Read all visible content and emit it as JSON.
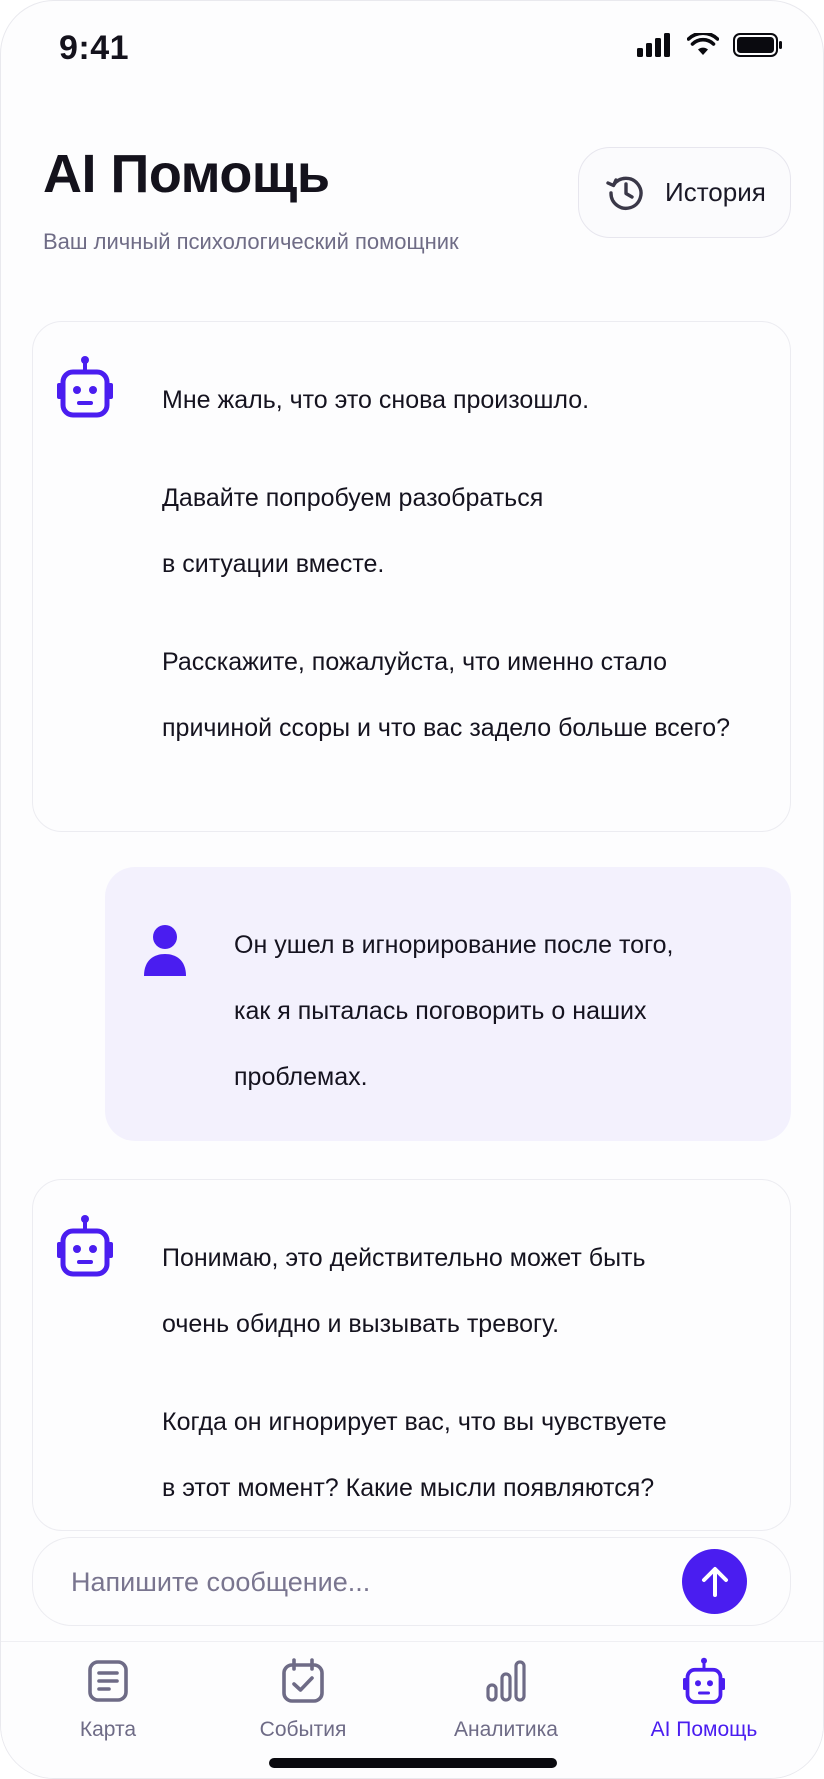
{
  "status_bar": {
    "time": "9:41"
  },
  "header": {
    "title": "AI Помощь",
    "subtitle": "Ваш личный психологический помощник",
    "history_label": "История"
  },
  "messages": [
    {
      "role": "bot",
      "lines": [
        "Мне жаль, что это снова произошло.",
        "Давайте попробуем разобраться",
        "в ситуации вместе.",
        "Расскажите, пожалуйста, что именно стало",
        "причиной ссоры и что вас задело больше всего?"
      ]
    },
    {
      "role": "user",
      "lines": [
        "Он ушел в игнорирование после того,",
        "как я пыталась поговорить о наших",
        "проблемах."
      ]
    },
    {
      "role": "bot",
      "lines": [
        "Понимаю, это действительно может быть",
        "очень обидно и вызывать тревогу.",
        "Когда он игнорирует вас, что вы чувствуете",
        "в этот момент? Какие мысли появляются?"
      ]
    }
  ],
  "composer": {
    "placeholder": "Напишите сообщение..."
  },
  "nav": {
    "items": [
      {
        "label": "Карта",
        "icon": "notes-icon",
        "active": false
      },
      {
        "label": "События",
        "icon": "calendar-check-icon",
        "active": false
      },
      {
        "label": "Аналитика",
        "icon": "bar-chart-icon",
        "active": false
      },
      {
        "label": "AI Помощь",
        "icon": "robot-icon",
        "active": true
      }
    ]
  },
  "colors": {
    "accent": "#4a1df0",
    "user_bubble": "#f3f1fd",
    "muted_text": "#6f6c86"
  }
}
